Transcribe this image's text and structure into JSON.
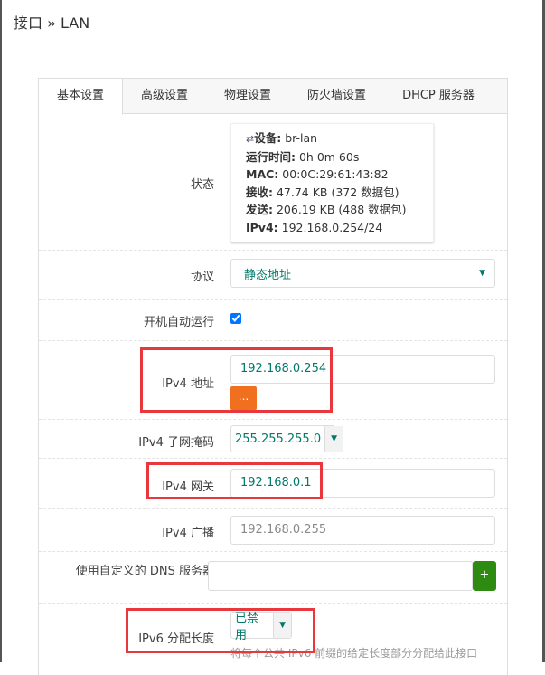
{
  "breadcrumb": "接口 » LAN",
  "tabs": [
    "基本设置",
    "高级设置",
    "物理设置",
    "防火墙设置",
    "DHCP 服务器"
  ],
  "status": {
    "label": "状态",
    "device_k": "设备:",
    "device_v": " br-lan",
    "uptime_k": "运行时间:",
    "uptime_v": " 0h 0m 60s",
    "mac_k": "MAC:",
    "mac_v": " 00:0C:29:61:43:82",
    "rx_k": "接收:",
    "rx_v": " 47.74 KB (372 数据包)",
    "tx_k": "发送:",
    "tx_v": " 206.19 KB (488 数据包)",
    "ipv4_k": "IPv4:",
    "ipv4_v": " 192.168.0.254/24"
  },
  "protocol": {
    "label": "协议",
    "value": "静态地址"
  },
  "autostart": {
    "label": "开机自动运行",
    "checked": true
  },
  "ipv4addr": {
    "label": "IPv4 地址",
    "value": "192.168.0.254",
    "more": "..."
  },
  "netmask": {
    "label": "IPv4 子网掩码",
    "value": "255.255.255.0"
  },
  "gateway": {
    "label": "IPv4 网关",
    "value": "192.168.0.1"
  },
  "broadcast": {
    "label": "IPv4 广播",
    "placeholder": "192.168.0.255"
  },
  "dns": {
    "label": "使用自定义的 DNS 服务器",
    "add": "+"
  },
  "ipv6": {
    "label": "IPv6 分配长度",
    "value": "已禁用",
    "help": "将每个公共 IPv6 前缀的给定长度部分分配给此接口"
  }
}
